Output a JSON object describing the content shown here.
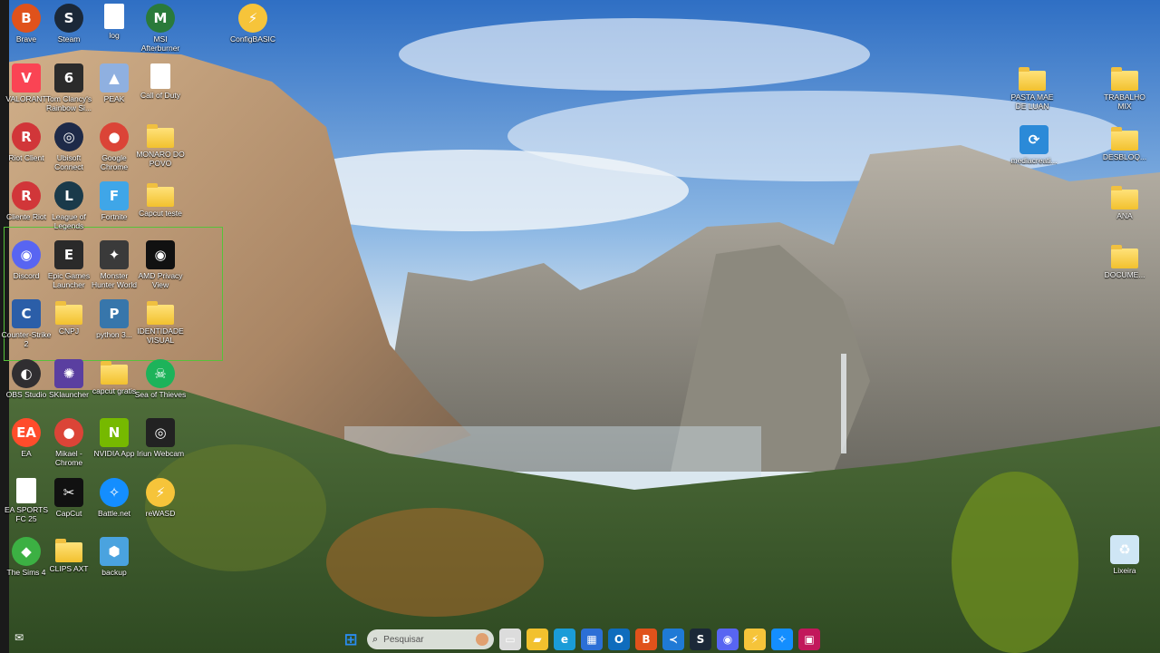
{
  "desktop": {
    "left_icons": [
      {
        "label": "Brave",
        "icon": "brave-icon",
        "color": "#e0521b",
        "glyph": "B",
        "shape": "round"
      },
      {
        "label": "Steam",
        "icon": "steam-icon",
        "color": "#1b2838",
        "glyph": "S",
        "shape": "round"
      },
      {
        "label": "log",
        "icon": "document-icon",
        "color": "#ffffff",
        "glyph": "",
        "shape": "doc"
      },
      {
        "label": "MSI Afterburner",
        "icon": "msi-afterburner-icon",
        "color": "#2a7a3a",
        "glyph": "M",
        "shape": "round"
      },
      {
        "label": "ConfigBASIC",
        "icon": "lightning-icon",
        "color": "#f6c43a",
        "glyph": "⚡",
        "shape": "round"
      },
      {
        "label": "VALORANT",
        "icon": "valorant-icon",
        "color": "#fa4454",
        "glyph": "V",
        "shape": "square"
      },
      {
        "label": "Tom Clancy's Rainbow Si...",
        "icon": "rainbow-six-icon",
        "color": "#2b2b2b",
        "glyph": "6",
        "shape": "square"
      },
      {
        "label": "PEAK",
        "icon": "peak-icon",
        "color": "#8fb0e0",
        "glyph": "▲",
        "shape": "square"
      },
      {
        "label": "Call of Duty",
        "icon": "document-icon",
        "color": "#ffffff",
        "glyph": "",
        "shape": "doc"
      },
      {
        "label": "Riot Client",
        "icon": "riot-client-icon",
        "color": "#d13639",
        "glyph": "R",
        "shape": "round"
      },
      {
        "label": "Ubisoft Connect",
        "icon": "ubisoft-icon",
        "color": "#1e2a48",
        "glyph": "◎",
        "shape": "round"
      },
      {
        "label": "Google Chrome",
        "icon": "chrome-icon",
        "color": "#db4437",
        "glyph": "●",
        "shape": "round"
      },
      {
        "label": "MONARO DO POVO",
        "icon": "folder-icon",
        "color": "#f2c12e",
        "glyph": "",
        "shape": "folder"
      },
      {
        "label": "Cliente Riot",
        "icon": "riot-client-icon",
        "color": "#d13639",
        "glyph": "R",
        "shape": "round"
      },
      {
        "label": "League of Legends",
        "icon": "league-of-legends-icon",
        "color": "#1a3a4a",
        "glyph": "L",
        "shape": "round"
      },
      {
        "label": "Fortnite",
        "icon": "fortnite-icon",
        "color": "#3fa6e8",
        "glyph": "F",
        "shape": "square"
      },
      {
        "label": "Capcut teste",
        "icon": "folder-icon",
        "color": "#f2c12e",
        "glyph": "",
        "shape": "folder"
      },
      {
        "label": "Discord",
        "icon": "discord-icon",
        "color": "#5865f2",
        "glyph": "◉",
        "shape": "round"
      },
      {
        "label": "Epic Games Launcher",
        "icon": "epic-games-icon",
        "color": "#2a2a2a",
        "glyph": "E",
        "shape": "square"
      },
      {
        "label": "Monster Hunter World",
        "icon": "monster-hunter-icon",
        "color": "#3a3a3a",
        "glyph": "✦",
        "shape": "square"
      },
      {
        "label": "AMD Privacy View",
        "icon": "amd-privacy-view-icon",
        "color": "#111111",
        "glyph": "◉",
        "shape": "square"
      },
      {
        "label": "Counter-Strike 2",
        "icon": "counter-strike-icon",
        "color": "#2b5ea8",
        "glyph": "C",
        "shape": "square"
      },
      {
        "label": "CNPJ",
        "icon": "folder-icon",
        "color": "#f2c12e",
        "glyph": "",
        "shape": "folder"
      },
      {
        "label": "python 3...",
        "icon": "python-icon",
        "color": "#3776ab",
        "glyph": "P",
        "shape": "square"
      },
      {
        "label": "IDENTIDADE VISUAL",
        "icon": "folder-icon",
        "color": "#f2c12e",
        "glyph": "",
        "shape": "folder"
      },
      {
        "label": "OBS Studio",
        "icon": "obs-icon",
        "color": "#302e31",
        "glyph": "◐",
        "shape": "round"
      },
      {
        "label": "SKlauncher",
        "icon": "sklauncher-icon",
        "color": "#5a3fa0",
        "glyph": "✺",
        "shape": "square"
      },
      {
        "label": "capcut gratis",
        "icon": "folder-icon",
        "color": "#f2c12e",
        "glyph": "",
        "shape": "folder"
      },
      {
        "label": "Sea of Thieves",
        "icon": "sea-of-thieves-icon",
        "color": "#1db35a",
        "glyph": "☠",
        "shape": "round"
      },
      {
        "label": "EA",
        "icon": "ea-icon",
        "color": "#ff4c2b",
        "glyph": "EA",
        "shape": "round"
      },
      {
        "label": "Mikael - Chrome",
        "icon": "chrome-icon",
        "color": "#db4437",
        "glyph": "●",
        "shape": "round"
      },
      {
        "label": "NVIDIA App",
        "icon": "nvidia-icon",
        "color": "#76b900",
        "glyph": "N",
        "shape": "square"
      },
      {
        "label": "Iriun Webcam",
        "icon": "iriun-webcam-icon",
        "color": "#222222",
        "glyph": "◎",
        "shape": "square"
      },
      {
        "label": "EA SPORTS FC 25",
        "icon": "document-icon",
        "color": "#ffffff",
        "glyph": "",
        "shape": "doc"
      },
      {
        "label": "CapCut",
        "icon": "capcut-icon",
        "color": "#111111",
        "glyph": "✂",
        "shape": "square"
      },
      {
        "label": "Battle.net",
        "icon": "battlenet-icon",
        "color": "#148eff",
        "glyph": "✧",
        "shape": "round"
      },
      {
        "label": "reWASD",
        "icon": "rewasd-icon",
        "color": "#f6c43a",
        "glyph": "⚡",
        "shape": "round"
      },
      {
        "label": "The Sims 4",
        "icon": "sims-icon",
        "color": "#3cb043",
        "glyph": "◆",
        "shape": "round"
      },
      {
        "label": "CLIPS AXT",
        "icon": "folder-icon",
        "color": "#f2c12e",
        "glyph": "",
        "shape": "folder"
      },
      {
        "label": "backup",
        "icon": "backup-icon",
        "color": "#4aa3df",
        "glyph": "⬢",
        "shape": "square"
      }
    ],
    "right_icons": [
      {
        "label": "PASTA MAE DE LUAN",
        "icon": "folder-icon",
        "color": "#f2c12e",
        "glyph": "",
        "shape": "folder"
      },
      {
        "label": "TRABALHO MIX",
        "icon": "folder-icon",
        "color": "#f2c12e",
        "glyph": "",
        "shape": "folder"
      },
      {
        "label": "mediacreati...",
        "icon": "media-creation-tool-icon",
        "color": "#2b8ad8",
        "glyph": "⟳",
        "shape": "square"
      },
      {
        "label": "DESBLOQ...",
        "icon": "folder-icon",
        "color": "#f2c12e",
        "glyph": "",
        "shape": "folder"
      },
      {
        "label": "ANA",
        "icon": "folder-icon",
        "color": "#f2c12e",
        "glyph": "",
        "shape": "folder"
      },
      {
        "label": "DOCUME...",
        "icon": "folder-icon",
        "color": "#f2c12e",
        "glyph": "",
        "shape": "folder"
      },
      {
        "label": "Lixeira",
        "icon": "recycle-bin-icon",
        "color": "#cfe6f5",
        "glyph": "♻",
        "shape": "square"
      }
    ]
  },
  "taskbar": {
    "search_placeholder": "Pesquisar",
    "items": [
      {
        "icon": "windows-start-icon",
        "color": "#2a8cf0",
        "glyph": "⊞"
      },
      {
        "icon": "search-icon",
        "color": "",
        "glyph": ""
      },
      {
        "icon": "task-view-icon",
        "color": "#dcdcdc",
        "glyph": "▭"
      },
      {
        "icon": "file-explorer-icon",
        "color": "#f2c12e",
        "glyph": "▰"
      },
      {
        "icon": "edge-icon",
        "color": "#1a9cd8",
        "glyph": "e"
      },
      {
        "icon": "store-icon",
        "color": "#2c6fd6",
        "glyph": "▦"
      },
      {
        "icon": "outlook-icon",
        "color": "#0f6cbd",
        "glyph": "O"
      },
      {
        "icon": "brave-icon",
        "color": "#e0521b",
        "glyph": "B"
      },
      {
        "icon": "vscode-icon",
        "color": "#1f7ad6",
        "glyph": "≺"
      },
      {
        "icon": "steam-icon",
        "color": "#1b2838",
        "glyph": "S"
      },
      {
        "icon": "discord-icon",
        "color": "#5865f2",
        "glyph": "◉"
      },
      {
        "icon": "lightning-icon",
        "color": "#f6c43a",
        "glyph": "⚡"
      },
      {
        "icon": "battlenet-icon",
        "color": "#148eff",
        "glyph": "✧"
      },
      {
        "icon": "app-icon",
        "color": "#c2185b",
        "glyph": "▣"
      }
    ]
  }
}
